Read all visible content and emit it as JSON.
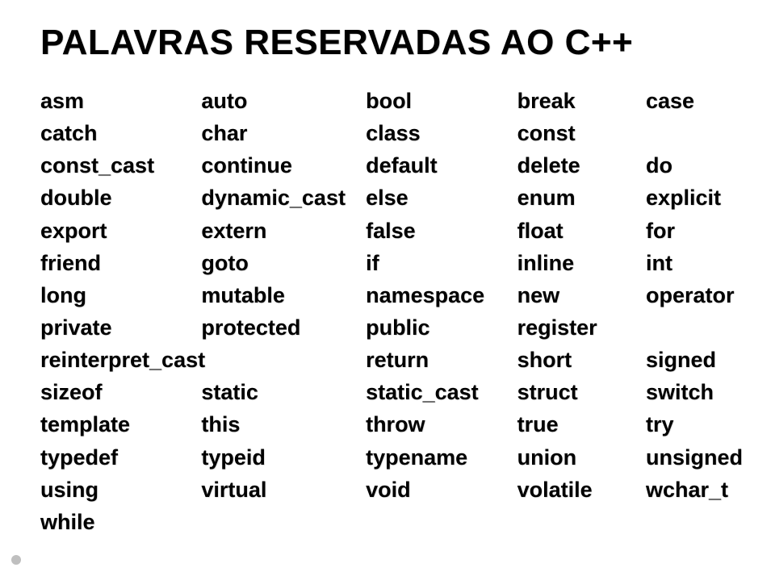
{
  "title": "PALAVRAS RESERVADAS AO C++",
  "rows": [
    [
      "asm",
      "auto",
      "bool",
      "break",
      "case"
    ],
    [
      "catch",
      "char",
      "class",
      "const",
      ""
    ],
    [
      "const_cast",
      "continue",
      "default",
      "delete",
      "do"
    ],
    [
      "double",
      "dynamic_cast",
      "else",
      "enum",
      "explicit"
    ],
    [
      "export",
      "extern",
      "false",
      "float",
      "for"
    ],
    [
      "friend",
      "goto",
      "if",
      "inline",
      "int"
    ],
    [
      "long",
      "mutable",
      "namespace",
      "new",
      "operator"
    ],
    [
      "private",
      "protected",
      "public",
      "register",
      ""
    ],
    [
      "reinterpret_cast",
      "",
      "return",
      "short",
      "signed"
    ],
    [
      "sizeof",
      "static",
      "static_cast",
      "struct",
      "switch"
    ],
    [
      "template",
      "this",
      "throw",
      "true",
      "try"
    ],
    [
      "typedef",
      "typeid",
      "typename",
      "union",
      "unsigned"
    ],
    [
      "using",
      "virtual",
      "void",
      "volatile",
      "wchar_t"
    ],
    [
      "while",
      "",
      "",
      "",
      ""
    ]
  ]
}
